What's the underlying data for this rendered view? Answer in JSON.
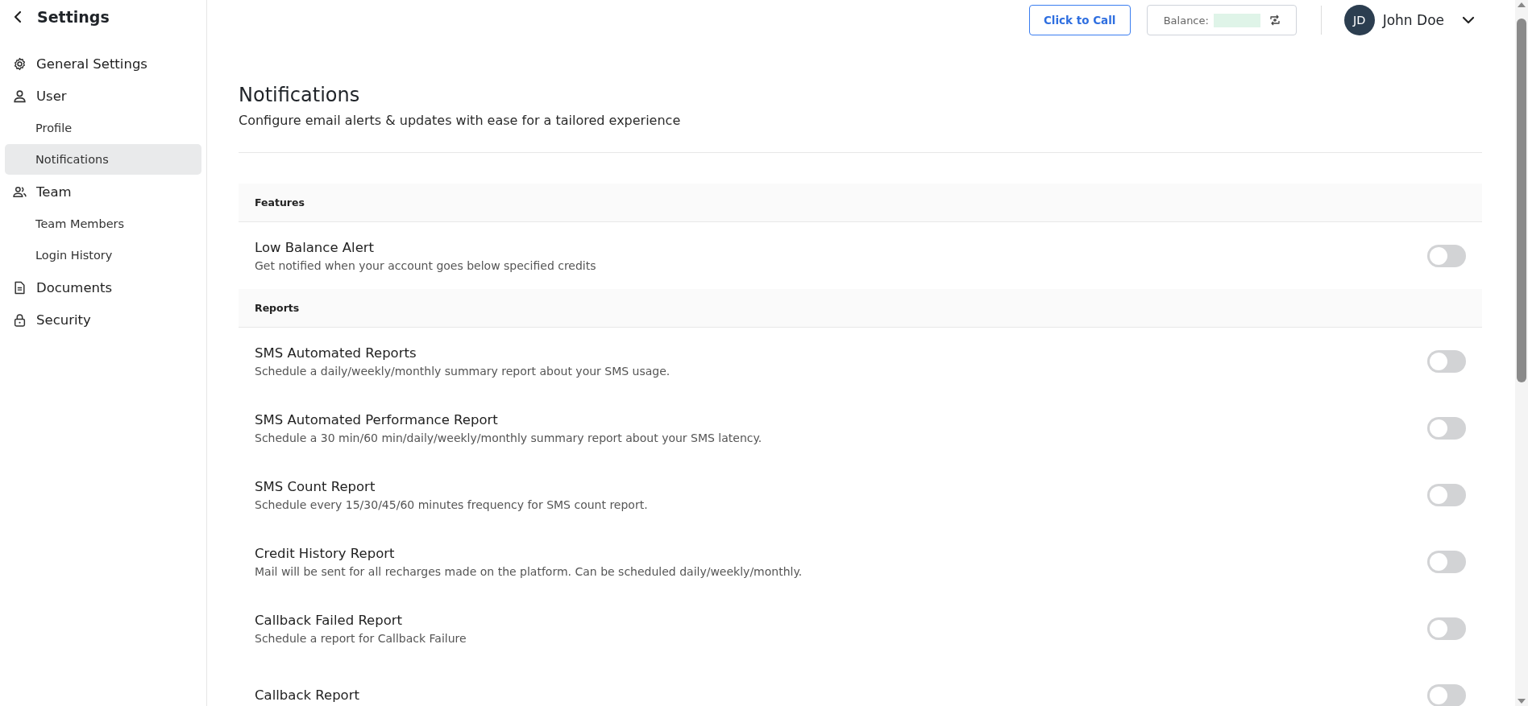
{
  "sidebar": {
    "title": "Settings",
    "items": [
      {
        "label": "General Settings",
        "kind": "gear",
        "selected": false
      },
      {
        "label": "User",
        "kind": "user",
        "selected": false,
        "children": [
          {
            "label": "Profile",
            "selected": false
          },
          {
            "label": "Notifications",
            "selected": true
          }
        ]
      },
      {
        "label": "Team",
        "kind": "team",
        "selected": false,
        "children": [
          {
            "label": "Team Members",
            "selected": false
          },
          {
            "label": "Login History",
            "selected": false
          }
        ]
      },
      {
        "label": "Documents",
        "kind": "document",
        "selected": false
      },
      {
        "label": "Security",
        "kind": "lock",
        "selected": false
      }
    ]
  },
  "topbar": {
    "call_button": "Click to Call",
    "balance_label": "Balance:",
    "user": {
      "initials": "JD",
      "name": "John Doe"
    }
  },
  "page": {
    "title": "Notifications",
    "subtitle": "Configure email alerts & updates with ease for a tailored experience"
  },
  "sections": [
    {
      "heading": "Features",
      "items": [
        {
          "title": "Low Balance Alert",
          "description": "Get notified when your account goes below specified credits",
          "on": false
        }
      ]
    },
    {
      "heading": "Reports",
      "items": [
        {
          "title": "SMS Automated Reports",
          "description": "Schedule a daily/weekly/monthly summary report about your SMS usage.",
          "on": false
        },
        {
          "title": "SMS Automated Performance Report",
          "description": "Schedule a 30 min/60 min/daily/weekly/monthly summary report about your SMS latency.",
          "on": false
        },
        {
          "title": "SMS Count Report",
          "description": "Schedule every 15/30/45/60 minutes frequency for SMS count report.",
          "on": false
        },
        {
          "title": "Credit History Report",
          "description": "Mail will be sent for all recharges made on the platform. Can be scheduled daily/weekly/monthly.",
          "on": false
        },
        {
          "title": "Callback Failed Report",
          "description": "Schedule a report for Callback Failure",
          "on": false
        },
        {
          "title": "Callback Report",
          "on": false
        }
      ]
    }
  ]
}
